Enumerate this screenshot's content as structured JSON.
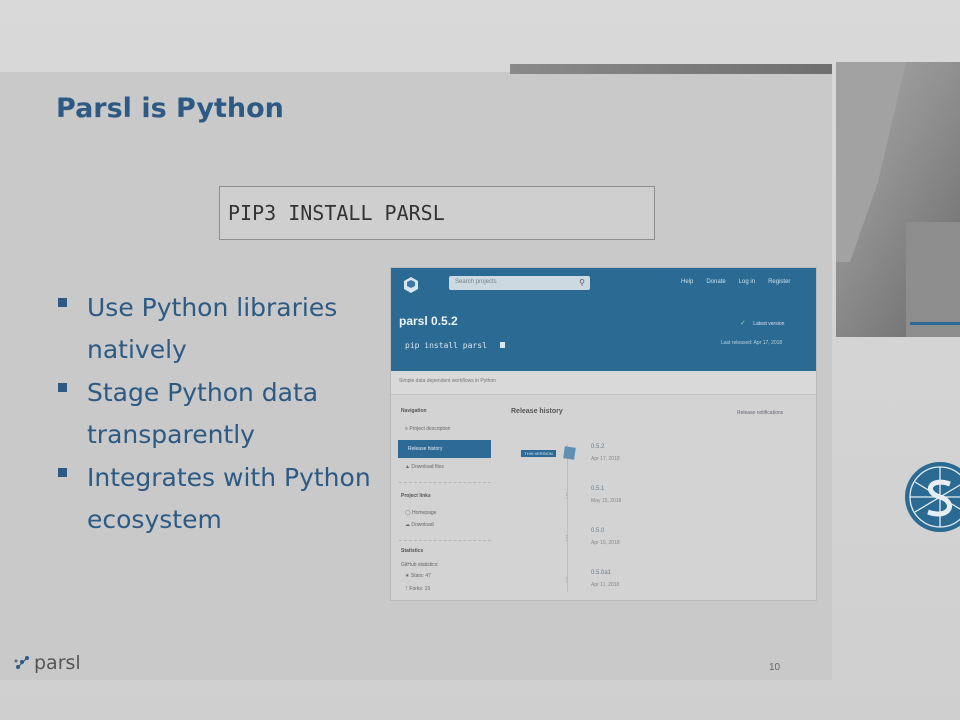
{
  "slide": {
    "title": "Parsl is Python",
    "code": "PIP3 INSTALL PARSL",
    "bullets": [
      "Use Python libraries natively",
      "Stage Python data transparently",
      "Integrates with Python ecosystem"
    ],
    "logo_text": "parsl",
    "page_number": "10"
  },
  "pypi": {
    "search_placeholder": "Search projects",
    "nav": [
      "Help",
      "Donate",
      "Log in",
      "Register"
    ],
    "project_title": "parsl 0.5.2",
    "install_command": "pip install parsl",
    "latest_version_label": "Latest version",
    "released_label": "Last released: Apr 17, 2018",
    "summary": "Simple data dependent workflows in Python",
    "navigation_heading": "Navigation",
    "nav_items": [
      "Project description",
      "Release history",
      "Download files"
    ],
    "project_links_heading": "Project links",
    "project_links": [
      "Homepage",
      "Download"
    ],
    "statistics_heading": "Statistics",
    "github_stats_label": "GitHub statistics:",
    "stats": [
      "Stars: 47",
      "Forks: 15"
    ],
    "release_history_heading": "Release history",
    "release_notifications": "Release notifications",
    "this_version_badge": "THIS VERSION",
    "releases": [
      {
        "version": "0.5.2",
        "date": "Apr 17, 2018"
      },
      {
        "version": "0.5.1",
        "date": "May 15, 2018"
      },
      {
        "version": "0.5.0",
        "date": "Apr 16, 2018"
      },
      {
        "version": "0.5.0a1",
        "date": "Apr 11, 2018"
      }
    ]
  },
  "colors": {
    "title_blue": "#2c5a84",
    "pypi_blue": "#2a6a93",
    "slide_bg": "#c9c9c9"
  }
}
